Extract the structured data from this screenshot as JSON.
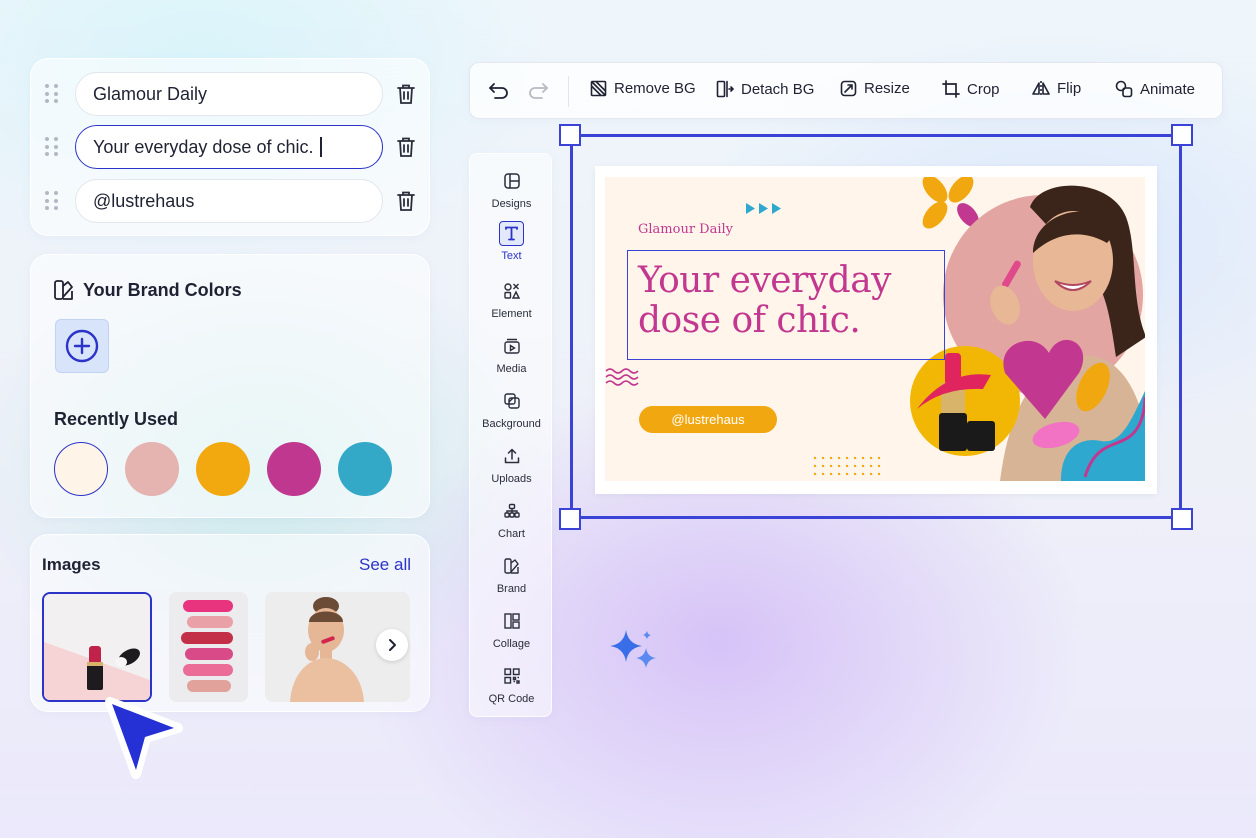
{
  "text_fields": [
    {
      "value": "Glamour Daily",
      "active": false
    },
    {
      "value": "Your everyday dose of chic.",
      "active": true
    },
    {
      "value": "@lustrehaus",
      "active": false
    }
  ],
  "brand": {
    "title": "Your Brand Colors",
    "recently_used_label": "Recently Used",
    "recent_colors": [
      "#fff4e8",
      "#e5b3b0",
      "#f2a80f",
      "#c0378f",
      "#33a9c7"
    ]
  },
  "images": {
    "title": "Images",
    "see_all": "See all"
  },
  "toolbar": {
    "undo_icon": "undo-icon",
    "redo_icon": "redo-icon",
    "items": [
      {
        "label": "Remove BG",
        "icon": "remove-bg-icon"
      },
      {
        "label": "Detach BG",
        "icon": "detach-bg-icon"
      },
      {
        "label": "Resize",
        "icon": "resize-icon"
      },
      {
        "label": "Crop",
        "icon": "crop-icon"
      },
      {
        "label": "Flip",
        "icon": "flip-icon"
      },
      {
        "label": "Animate",
        "icon": "animate-icon"
      }
    ]
  },
  "side_tools": [
    {
      "label": "Designs",
      "icon": "designs-icon"
    },
    {
      "label": "Text",
      "icon": "text-icon",
      "active": true
    },
    {
      "label": "Element",
      "icon": "element-icon"
    },
    {
      "label": "Media",
      "icon": "media-icon"
    },
    {
      "label": "Background",
      "icon": "background-icon"
    },
    {
      "label": "Uploads",
      "icon": "uploads-icon"
    },
    {
      "label": "Chart",
      "icon": "chart-icon"
    },
    {
      "label": "Brand",
      "icon": "brand-icon"
    },
    {
      "label": "Collage",
      "icon": "collage-icon"
    },
    {
      "label": "QR Code",
      "icon": "qr-code-icon"
    }
  ],
  "design": {
    "small_title": "Glamour Daily",
    "headline_line1": "Your everyday",
    "headline_line2": "dose of chic.",
    "handle": "@lustrehaus"
  },
  "colors": {
    "accent": "#2b33c8",
    "selection": "#3a43d6",
    "brand_pink": "#c2378f",
    "brand_orange": "#f1a70f",
    "brand_teal": "#33a9c7"
  }
}
